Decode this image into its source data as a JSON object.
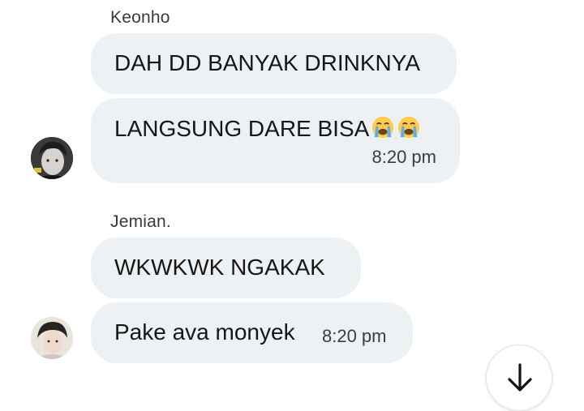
{
  "messages": [
    {
      "sender": "Keonho",
      "bubbles": [
        {
          "text": "DAH DD BANYAK DRINKNYA"
        },
        {
          "text": "LANGSUNG DARE BISA",
          "emoji": [
            "loudly-crying-face",
            "loudly-crying-face"
          ],
          "time": "8:20 pm"
        }
      ],
      "avatar": "avatar-keonho"
    },
    {
      "sender": "Jemian.",
      "bubbles": [
        {
          "text": "WKWKWK NGAKAK"
        },
        {
          "text": "Pake ava monyek",
          "time": "8:20 pm"
        }
      ],
      "avatar": "avatar-jemian"
    }
  ],
  "scroll_button": {
    "icon": "arrow-down-icon"
  },
  "colors": {
    "bubble": "#eef1f3",
    "background": "#ffffff",
    "text": "#161616",
    "time": "#3c3c3c"
  }
}
